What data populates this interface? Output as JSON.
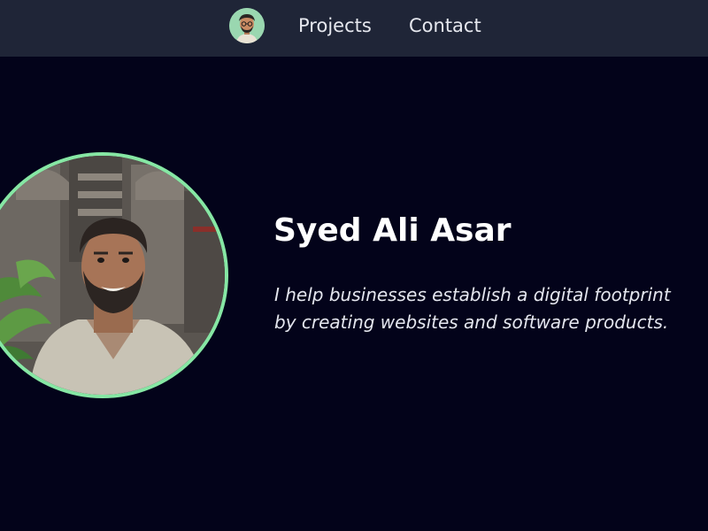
{
  "nav": {
    "avatar_icon": "cartoon-avatar-icon",
    "links": [
      {
        "label": "Projects"
      },
      {
        "label": "Contact"
      }
    ]
  },
  "hero": {
    "name": "Syed Ali Asar",
    "tagline_lines": [
      "I help businesses establish a digital footprint",
      "by creating websites and software products."
    ],
    "photo_icon": "profile-photo"
  },
  "colors": {
    "page_background": "#03031a",
    "navbar_background": "#1f2537",
    "photo_ring": "#86e7a4",
    "text": "#ffffff"
  }
}
